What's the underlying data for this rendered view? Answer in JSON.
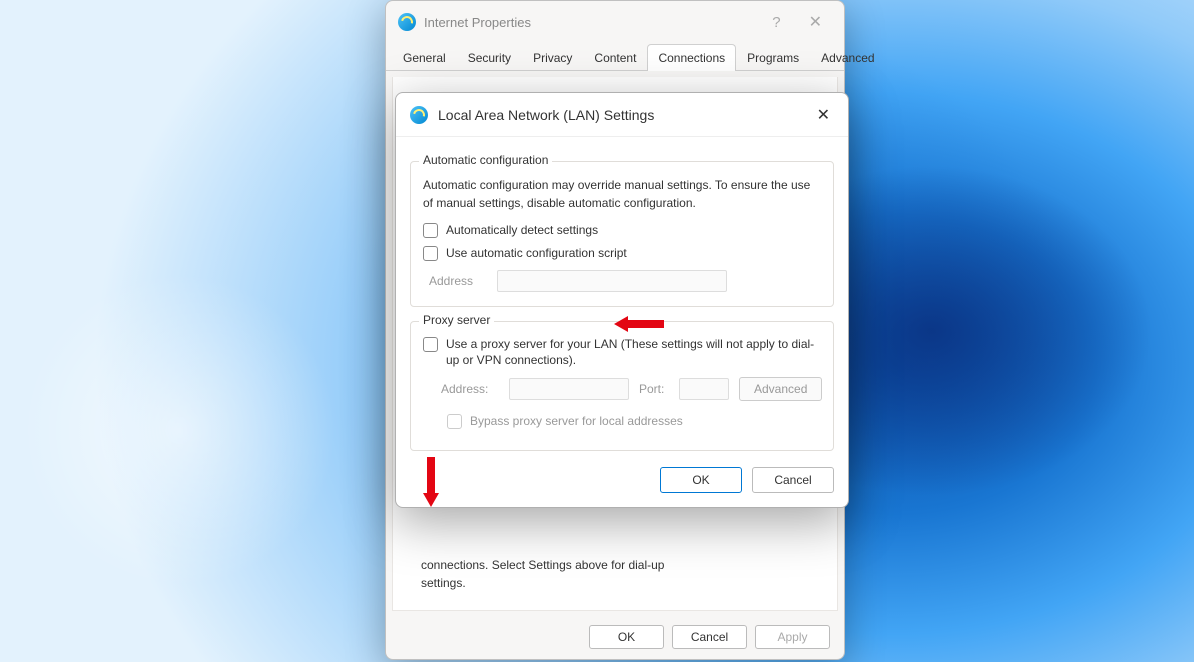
{
  "parent": {
    "title": "Internet Properties",
    "tabs": [
      "General",
      "Security",
      "Privacy",
      "Content",
      "Connections",
      "Programs",
      "Advanced"
    ],
    "active_tab": 4,
    "peek_line1": "connections. Select Settings above for dial-up",
    "peek_line2": "settings.",
    "buttons": {
      "ok": "OK",
      "cancel": "Cancel",
      "apply": "Apply"
    }
  },
  "lan": {
    "title": "Local Area Network (LAN) Settings",
    "auto_group": {
      "legend": "Automatic configuration",
      "description": "Automatic configuration may override manual settings.  To ensure the use of manual settings, disable automatic configuration.",
      "detect_label": "Automatically detect settings",
      "script_label": "Use automatic configuration script",
      "address_label": "Address"
    },
    "proxy_group": {
      "legend": "Proxy server",
      "use_label": "Use a proxy server for your LAN (These settings will not apply to dial-up or VPN connections).",
      "address_label": "Address:",
      "port_label": "Port:",
      "advanced": "Advanced",
      "bypass_label": "Bypass proxy server for local addresses"
    },
    "buttons": {
      "ok": "OK",
      "cancel": "Cancel"
    }
  }
}
